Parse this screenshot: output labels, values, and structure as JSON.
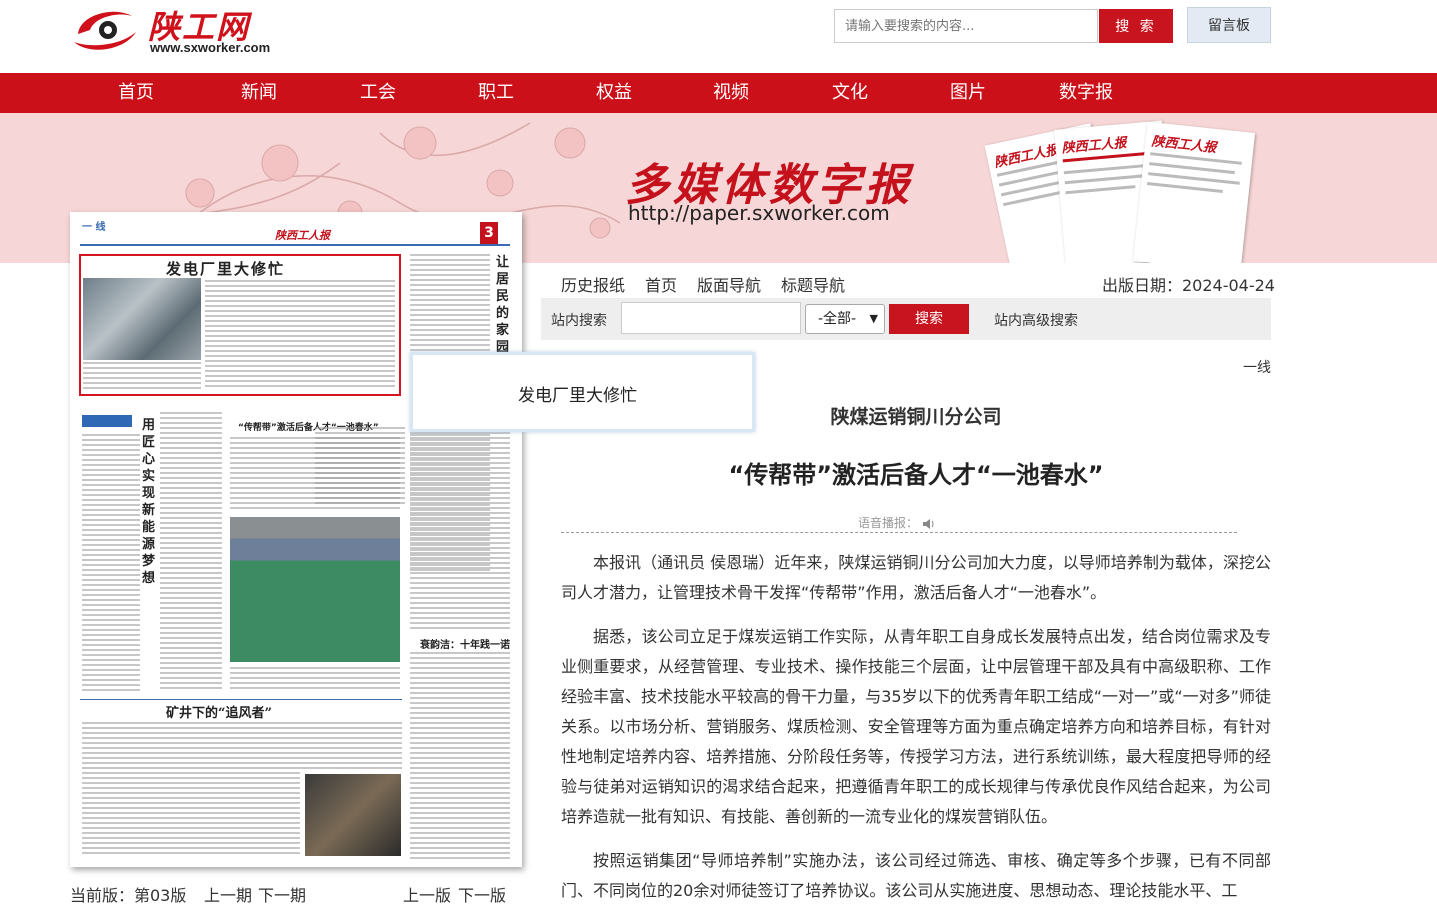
{
  "header": {
    "logo_cn": "陕工网",
    "logo_url": "www.sxworker.com",
    "search_placeholder": "请输入要搜索的内容...",
    "search_button": "搜 索",
    "message_button": "留言板"
  },
  "nav": {
    "items": [
      "首页",
      "新闻",
      "工会",
      "职工",
      "权益",
      "视频",
      "文化",
      "图片",
      "数字报"
    ]
  },
  "banner": {
    "title": "多媒体数字报",
    "url": "http://paper.sxworker.com",
    "paper_titles": [
      "陕西工人报",
      "陕西工人报",
      "陕西工人报"
    ]
  },
  "newspaper_page": {
    "section": "一 线",
    "masthead": "陕西工人报",
    "page_no": "3",
    "headline_1": "发电厂里大修忙",
    "vertical_title_1": "让居民的家园",
    "vertical_title_2": "用匠心实现新能源梦想",
    "subhead_1": "“传帮带”激活后备人才“一池春水”",
    "subhead_2": "衰韵洁：十年践一诺",
    "headline_2": "矿井下的“追风者”"
  },
  "popup": {
    "text": "发电厂里大修忙"
  },
  "subnav": {
    "items": [
      "历史报纸",
      "首页",
      "版面导航",
      "标题导航"
    ],
    "pub_date": "出版日期：2024-04-24"
  },
  "site_search": {
    "label": "站内搜索",
    "select_value": "-全部-",
    "button": "搜索",
    "advanced": "站内高级搜索"
  },
  "article": {
    "column": "一线",
    "kicker": "陕煤运销铜川分公司",
    "headline": "“传帮带”激活后备人才“一池春水”",
    "tts_label": "语音播报：",
    "paragraphs": [
      "本报讯（通讯员 侯恩瑞）近年来，陕煤运销铜川分公司加大力度，以导师培养制为载体，深挖公司人才潜力，让管理技术骨干发挥“传帮带”作用，激活后备人才“一池春水”。",
      "据悉，该公司立足于煤炭运销工作实际，从青年职工自身成长发展特点出发，结合岗位需求及专业侧重要求，从经营管理、专业技术、操作技能三个层面，让中层管理干部及具有中高级职称、工作经验丰富、技术技能水平较高的骨干力量，与35岁以下的优秀青年职工结成“一对一”或“一对多”师徒关系。以市场分析、营销服务、煤质检测、安全管理等方面为重点确定培养方向和培养目标，有针对性地制定培养内容、培养措施、分阶段任务等，传授学习方法，进行系统训练，最大程度把导师的经验与徒弟对运销知识的渴求结合起来，把遵循青年职工的成长规律与传承优良作风结合起来，为公司培养造就一批有知识、有技能、善创新的一流专业化的煤炭营销队伍。",
      "按照运销集团“导师培养制”实施办法，该公司经过筛选、审核、确定等多个步骤，已有不同部门、不同岗位的20余对师徒签订了培养协议。该公司从实施进度、思想动态、理论技能水平、工"
    ]
  },
  "pager": {
    "current": "当前版：第03版",
    "prev_issue": "上一期",
    "next_issue": "下一期",
    "prev_page": "上一版",
    "next_page": "下一版"
  }
}
